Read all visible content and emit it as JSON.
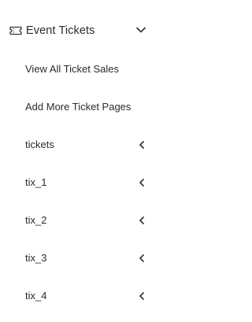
{
  "menu": {
    "header": {
      "label": "Event Tickets",
      "icon": "ticket-icon",
      "toggle_icon": "chevron-down-icon",
      "expanded": true
    },
    "items": [
      {
        "label": "View All Ticket Sales",
        "submenu": false
      },
      {
        "label": "Add More Ticket Pages",
        "submenu": false
      },
      {
        "label": "tickets",
        "submenu": true,
        "icon": "chevron-left-icon"
      },
      {
        "label": "tix_1",
        "submenu": true,
        "icon": "chevron-left-icon"
      },
      {
        "label": "tix_2",
        "submenu": true,
        "icon": "chevron-left-icon"
      },
      {
        "label": "tix_3",
        "submenu": true,
        "icon": "chevron-left-icon"
      },
      {
        "label": "tix_4",
        "submenu": true,
        "icon": "chevron-left-icon"
      }
    ]
  },
  "colors": {
    "text": "#2b2b2b",
    "background": "#ffffff"
  }
}
